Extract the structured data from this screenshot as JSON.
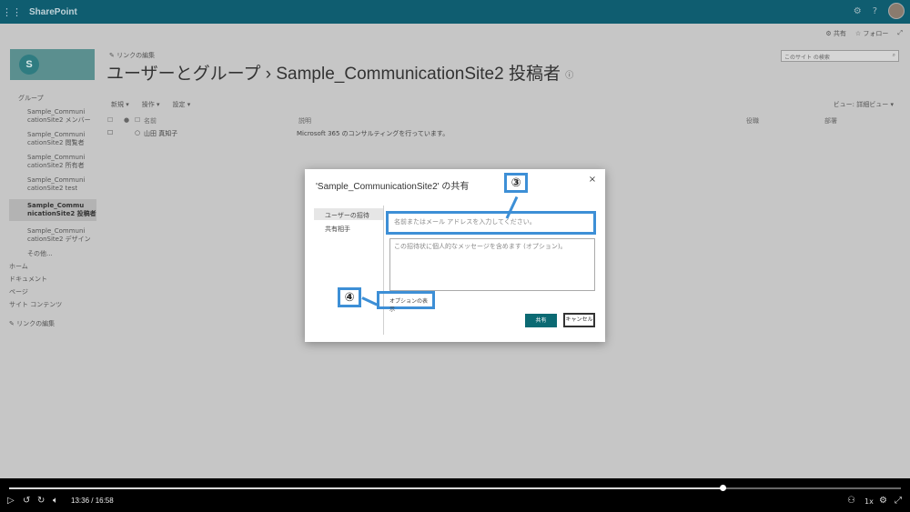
{
  "suite": {
    "brand": "SharePoint",
    "settings_icon": "gear-icon",
    "help_label": "?"
  },
  "top_actions": {
    "share": "共有",
    "follow": "フォロー"
  },
  "site": {
    "logo_letter": "S"
  },
  "header": {
    "edit_links": "リンクの編集",
    "title": "ユーザーとグループ › Sample_CommunicationSite2 投稿者",
    "search_placeholder": "このサイト の検索"
  },
  "leftnav": {
    "group_heading": "グループ",
    "groups": [
      {
        "label": "Sample_Communi cationSite2 メンバー",
        "selected": false
      },
      {
        "label": "Sample_Communi cationSite2 閲覧者",
        "selected": false
      },
      {
        "label": "Sample_Communi cationSite2 所有者",
        "selected": false
      },
      {
        "label": "Sample_Communi cationSite2 test",
        "selected": false
      },
      {
        "label": "Sample_Commu nicationSite2 投稿者",
        "selected": true
      },
      {
        "label": "Sample_Communi cationSite2 デザイン",
        "selected": false
      }
    ],
    "more": "その他...",
    "home": "ホーム",
    "documents": "ドキュメント",
    "pages": "ページ",
    "site_contents": "サイト コンテンツ",
    "edit_links": "リンクの編集"
  },
  "toolbar": {
    "new": "新規",
    "actions": "操作",
    "settings": "設定",
    "view_label": "ビュー:",
    "view_value": "詳細ビュー"
  },
  "list": {
    "headers": {
      "name": "名前",
      "about": "説明",
      "title": "役職",
      "department": "部署"
    },
    "rows": [
      {
        "name": "山田 真知子",
        "about": "Microsoft 365 のコンサルティングを行っています。"
      }
    ]
  },
  "dialog": {
    "title": "'Sample_CommunicationSite2' の共有",
    "close": "×",
    "tabs": [
      "ユーザーの招待",
      "共有相手"
    ],
    "name_placeholder": "名前またはメール アドレスを入力してください。",
    "message_placeholder": "この招待状に個人的なメッセージを含めます (オプション)。",
    "options_link": "オプションの表示",
    "share_button": "共有",
    "cancel_button": "キャンセル"
  },
  "callouts": {
    "step3": "③",
    "step4": "④"
  },
  "player": {
    "time": "13:36 / 16:58",
    "progress": 0.8,
    "speed": "1x"
  }
}
